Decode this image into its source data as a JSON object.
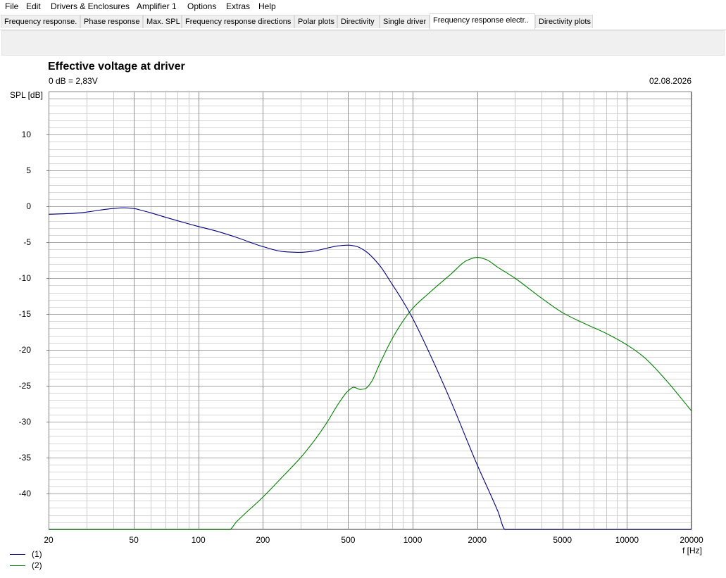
{
  "menu": {
    "items": [
      "File",
      "Edit",
      "Drivers & Enclosures",
      "Amplifier 1",
      "Options",
      "Extras",
      "Help"
    ]
  },
  "tabs": [
    {
      "label": "Frequency response."
    },
    {
      "label": "Phase response"
    },
    {
      "label": "Max. SPL"
    },
    {
      "label": "Frequency response directions"
    },
    {
      "label": "Polar plots"
    },
    {
      "label": "Directivity"
    },
    {
      "label": "Single driver"
    },
    {
      "label": "Frequency response electr..",
      "active": true
    },
    {
      "label": "Directivity plots"
    }
  ],
  "chart": {
    "title": "Effective voltage at driver",
    "subtitle": "0 dB = 2,83V",
    "date": "02.08.2026",
    "ylabel": "SPL [dB]",
    "xlabel": "f [Hz]"
  },
  "legend": [
    {
      "label": "(1)",
      "color": "#000080"
    },
    {
      "label": "(2)",
      "color": "#008000"
    }
  ],
  "chart_data": {
    "type": "line",
    "title": "Effective voltage at driver",
    "subtitle": "0 dB = 2,83V",
    "xlabel": "f [Hz]",
    "ylabel": "SPL [dB]",
    "xscale": "log",
    "xlim": [
      20,
      20000
    ],
    "ylim": [
      -45,
      16
    ],
    "x_ticks": [
      20,
      50,
      100,
      200,
      500,
      1000,
      2000,
      5000,
      10000,
      20000
    ],
    "x_tick_labels": [
      "20",
      "50",
      "100",
      "200",
      "500",
      "1000",
      "2000",
      "5000",
      "10000",
      "20000"
    ],
    "y_ticks": [
      10,
      5,
      0,
      -5,
      -10,
      -15,
      -20,
      -25,
      -30,
      -35,
      -40
    ],
    "y_tick_labels": [
      "10",
      "5",
      "0",
      "-5",
      "-10",
      "-15",
      "-20",
      "-25",
      "-30",
      "-35",
      "-40"
    ],
    "grid": true,
    "legend_position": "bottom-left",
    "series": [
      {
        "name": "(1)",
        "color": "#000080",
        "points": [
          [
            20,
            -1.1
          ],
          [
            25,
            -1.0
          ],
          [
            30,
            -0.8
          ],
          [
            35,
            -0.5
          ],
          [
            40,
            -0.3
          ],
          [
            45,
            -0.2
          ],
          [
            50,
            -0.3
          ],
          [
            55,
            -0.6
          ],
          [
            60,
            -0.9
          ],
          [
            70,
            -1.5
          ],
          [
            80,
            -2.0
          ],
          [
            100,
            -2.8
          ],
          [
            120,
            -3.4
          ],
          [
            150,
            -4.3
          ],
          [
            200,
            -5.6
          ],
          [
            250,
            -6.3
          ],
          [
            300,
            -6.4
          ],
          [
            350,
            -6.2
          ],
          [
            400,
            -5.8
          ],
          [
            450,
            -5.5
          ],
          [
            500,
            -5.4
          ],
          [
            550,
            -5.6
          ],
          [
            600,
            -6.2
          ],
          [
            700,
            -8.2
          ],
          [
            800,
            -10.8
          ],
          [
            900,
            -13.2
          ],
          [
            1000,
            -15.6
          ],
          [
            1200,
            -20.5
          ],
          [
            1500,
            -27.0
          ],
          [
            2000,
            -36.0
          ],
          [
            2500,
            -42.5
          ],
          [
            2700,
            -45.0
          ],
          [
            20000,
            -45.0
          ]
        ]
      },
      {
        "name": "(2)",
        "color": "#008000",
        "points": [
          [
            20,
            -45.0
          ],
          [
            140,
            -45.0
          ],
          [
            150,
            -44.0
          ],
          [
            200,
            -40.5
          ],
          [
            250,
            -37.5
          ],
          [
            300,
            -35.0
          ],
          [
            350,
            -32.5
          ],
          [
            400,
            -30.0
          ],
          [
            450,
            -27.5
          ],
          [
            500,
            -25.7
          ],
          [
            530,
            -25.2
          ],
          [
            570,
            -25.5
          ],
          [
            600,
            -25.4
          ],
          [
            640,
            -24.5
          ],
          [
            700,
            -22.0
          ],
          [
            800,
            -18.5
          ],
          [
            900,
            -16.0
          ],
          [
            1000,
            -14.2
          ],
          [
            1200,
            -12.0
          ],
          [
            1500,
            -9.5
          ],
          [
            1800,
            -7.5
          ],
          [
            2000,
            -7.1
          ],
          [
            2200,
            -7.4
          ],
          [
            2500,
            -8.5
          ],
          [
            3000,
            -10.0
          ],
          [
            4000,
            -12.8
          ],
          [
            5000,
            -14.8
          ],
          [
            6000,
            -16.0
          ],
          [
            7000,
            -16.9
          ],
          [
            8000,
            -17.7
          ],
          [
            10000,
            -19.3
          ],
          [
            12000,
            -21.0
          ],
          [
            15000,
            -24.0
          ],
          [
            20000,
            -28.5
          ]
        ]
      }
    ]
  }
}
